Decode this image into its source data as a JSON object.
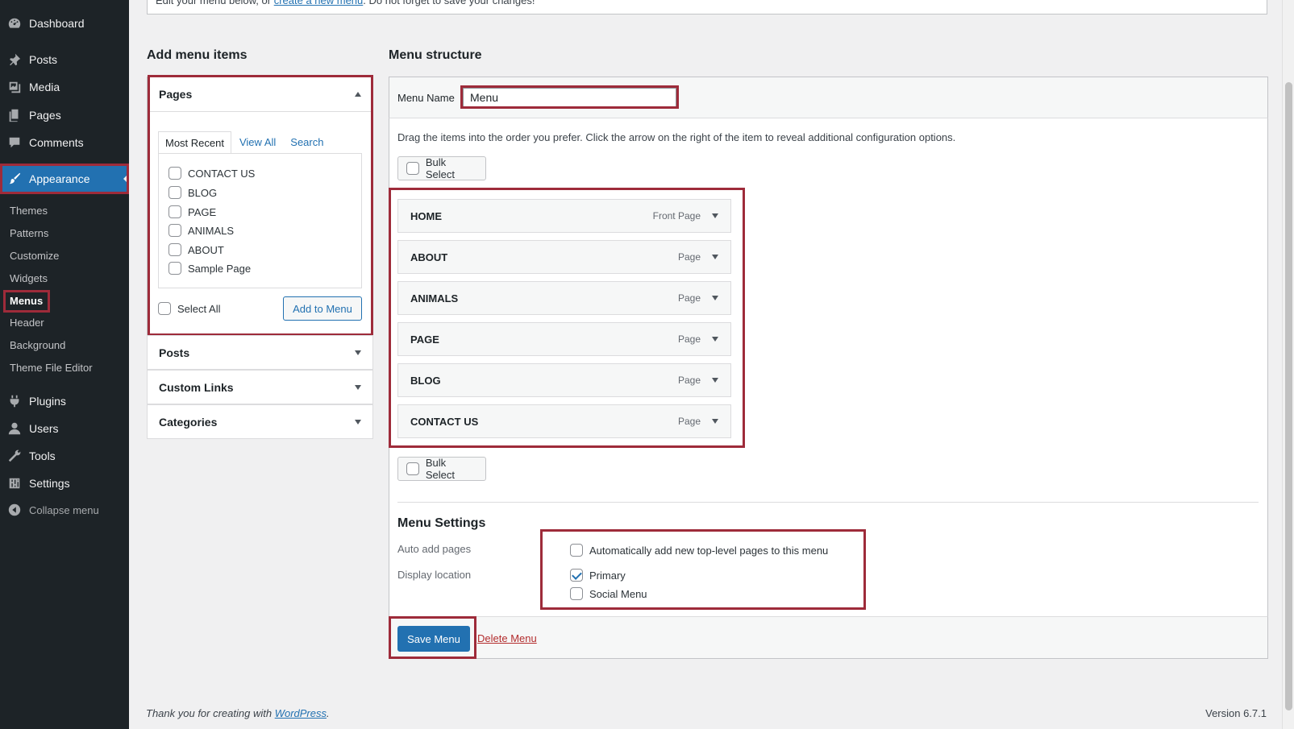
{
  "sidebar": {
    "items": {
      "dashboard": "Dashboard",
      "posts": "Posts",
      "media": "Media",
      "pages": "Pages",
      "comments": "Comments",
      "appearance": "Appearance",
      "plugins": "Plugins",
      "users": "Users",
      "tools": "Tools",
      "settings": "Settings",
      "collapse": "Collapse menu"
    },
    "submenu": {
      "themes": "Themes",
      "patterns": "Patterns",
      "customize": "Customize",
      "widgets": "Widgets",
      "menus": "Menus",
      "header": "Header",
      "background": "Background",
      "theme_file_editor": "Theme File Editor"
    }
  },
  "notice": {
    "text_before": "Edit your menu below, or ",
    "link": "create a new menu",
    "text_after": ". Do not forget to save your changes!"
  },
  "add_items": {
    "heading": "Add menu items",
    "pages": {
      "title": "Pages",
      "tabs": [
        "Most Recent",
        "View All",
        "Search"
      ],
      "items": [
        "CONTACT US",
        "BLOG",
        "PAGE",
        "ANIMALS",
        "ABOUT",
        "Sample Page"
      ],
      "select_all": "Select All",
      "add_button": "Add to Menu"
    },
    "sections": [
      "Posts",
      "Custom Links",
      "Categories"
    ]
  },
  "structure": {
    "heading": "Menu structure",
    "menu_name_label": "Menu Name",
    "menu_name_value": "Menu",
    "instructions": "Drag the items into the order you prefer. Click the arrow on the right of the item to reveal additional configuration options.",
    "bulk_select": "Bulk Select",
    "items": [
      {
        "title": "HOME",
        "type": "Front Page"
      },
      {
        "title": "ABOUT",
        "type": "Page"
      },
      {
        "title": "ANIMALS",
        "type": "Page"
      },
      {
        "title": "PAGE",
        "type": "Page"
      },
      {
        "title": "BLOG",
        "type": "Page"
      },
      {
        "title": "CONTACT US",
        "type": "Page"
      }
    ],
    "settings": {
      "heading": "Menu Settings",
      "auto_add_label": "Auto add pages",
      "auto_add_option": "Automatically add new top-level pages to this menu",
      "display_location_label": "Display location",
      "locations": [
        {
          "label": "Primary",
          "checked": true
        },
        {
          "label": "Social Menu",
          "checked": false
        }
      ]
    },
    "save_button": "Save Menu",
    "delete_link": "Delete Menu"
  },
  "footer": {
    "thanks_before": "Thank you for creating with ",
    "thanks_link": "WordPress",
    "thanks_after": ".",
    "version": "Version 6.7.1"
  },
  "colors": {
    "accent": "#2271b1",
    "sidebar_bg": "#1d2327",
    "highlight_border": "#9e2b3a",
    "danger": "#b32d2e"
  }
}
